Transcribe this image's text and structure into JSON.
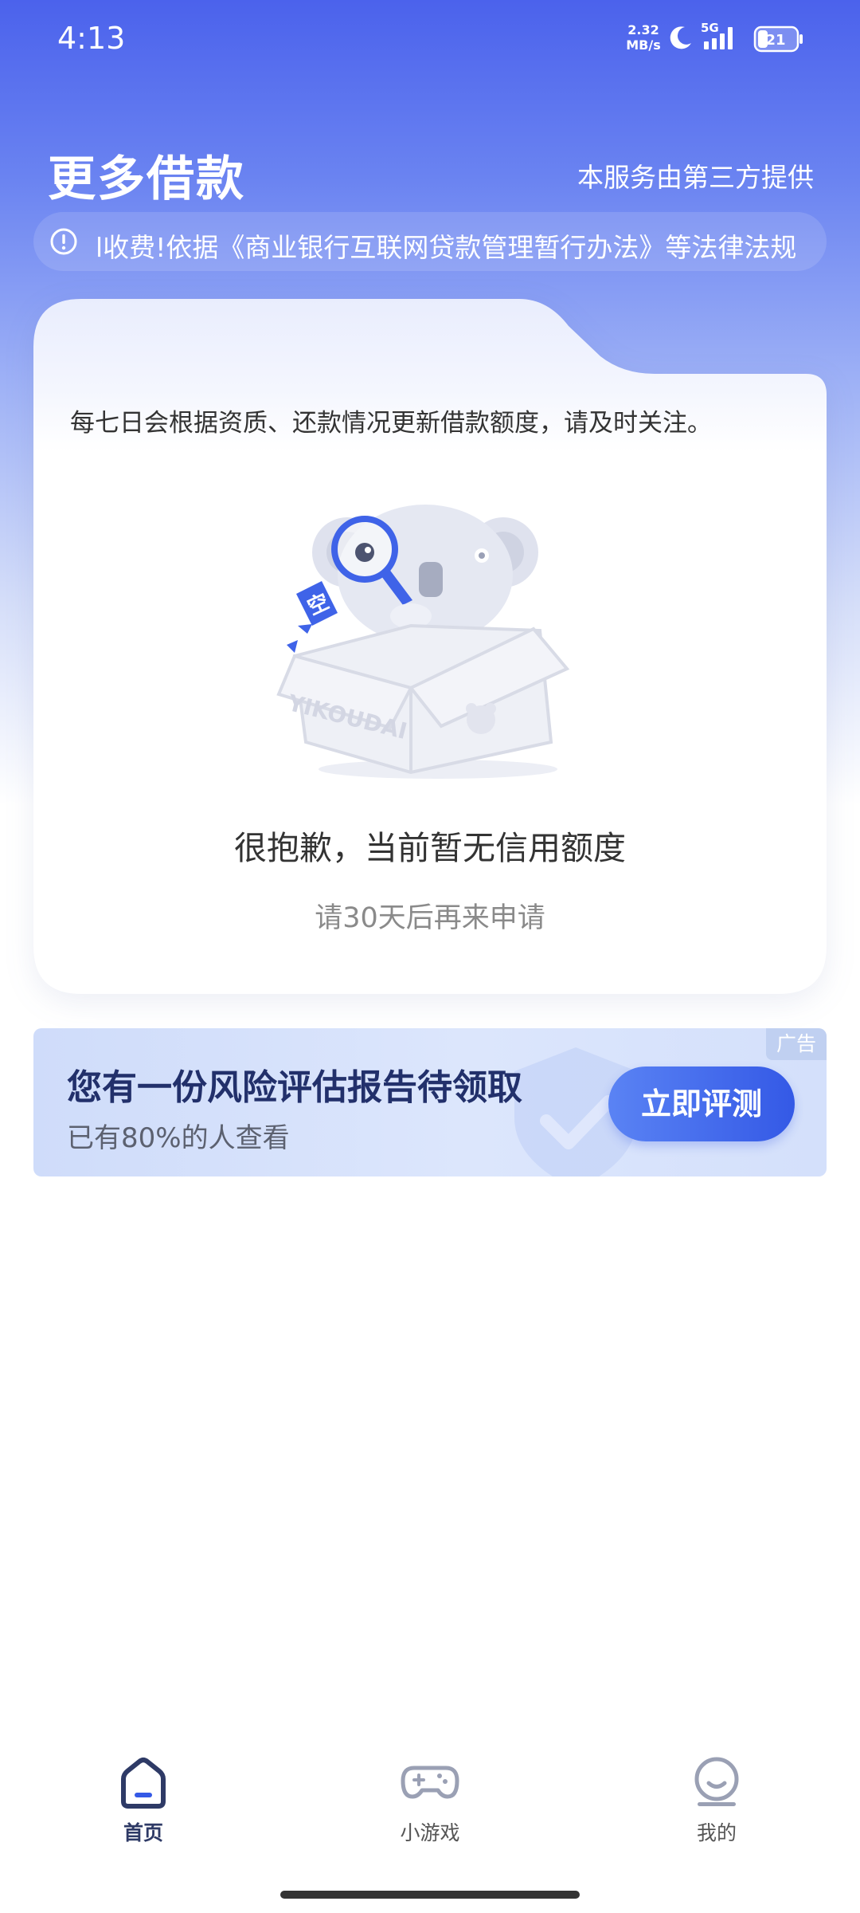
{
  "status_bar": {
    "time": "4:13",
    "network_speed_value": "2.32",
    "network_speed_unit": "MB/s",
    "network_type": "5G",
    "battery_level": "21"
  },
  "header": {
    "title": "更多借款",
    "provider_note": "本服务由第三方提供"
  },
  "notice": {
    "text": "l收费!依据《商业银行互联网贷款管理暂行办法》等法律法规"
  },
  "credit_card": {
    "refresh_note": "每七日会根据资质、还款情况更新借款额度，请及时关注。",
    "illustration_bubble_text": "空",
    "illustration_box_brand": "YIKOUDAI",
    "empty_title": "很抱歉，当前暂无信用额度",
    "empty_subtitle": "请30天后再来申请"
  },
  "ad": {
    "tag": "广告",
    "title": "您有一份风险评估报告待领取",
    "subtitle": "已有80%的人查看",
    "button_label": "立即评测"
  },
  "bottom_nav": {
    "items": [
      {
        "label": "首页",
        "icon": "home-icon",
        "active": true
      },
      {
        "label": "小游戏",
        "icon": "gamepad-icon",
        "active": false
      },
      {
        "label": "我的",
        "icon": "profile-icon",
        "active": false
      }
    ]
  },
  "colors": {
    "brand_blue": "#4b62ec",
    "ad_button": "#3459e6",
    "nav_active": "#2e3a66",
    "nav_inactive": "#9aa0b4"
  }
}
